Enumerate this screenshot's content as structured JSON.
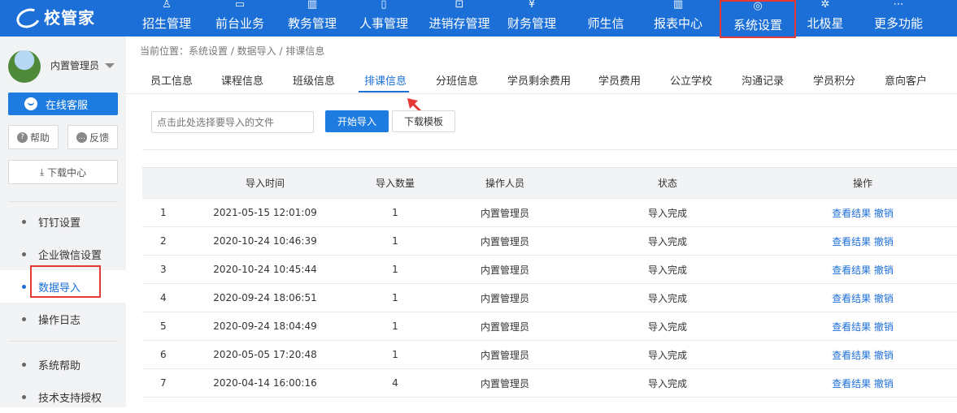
{
  "app": {
    "logo_text": "校管家"
  },
  "topnav": {
    "items": [
      {
        "label": "招生管理",
        "icon": "add-user-icon",
        "glyph": "♙"
      },
      {
        "label": "前台业务",
        "icon": "desk-icon",
        "glyph": "▭"
      },
      {
        "label": "教务管理",
        "icon": "book-icon",
        "glyph": "▥"
      },
      {
        "label": "人事管理",
        "icon": "person-icon",
        "glyph": "▯"
      },
      {
        "label": "进销存管理",
        "icon": "inventory-icon",
        "glyph": "⊡"
      },
      {
        "label": "财务管理",
        "icon": "finance-icon",
        "glyph": "¥"
      },
      {
        "label": "师生信",
        "icon": "message-icon",
        "glyph": ""
      },
      {
        "label": "报表中心",
        "icon": "report-icon",
        "glyph": "▥"
      },
      {
        "label": "系统设置",
        "icon": "settings-icon",
        "glyph": "◎"
      },
      {
        "label": "北极星",
        "icon": "star-icon",
        "glyph": "✲"
      },
      {
        "label": "更多功能",
        "icon": "more-icon",
        "glyph": "⋯"
      }
    ],
    "active_index": 8
  },
  "sidebar": {
    "username": "内置管理员",
    "online_service": "在线客服",
    "help": "帮助",
    "feedback": "反馈",
    "download_center": "下载中心",
    "menu": [
      {
        "label": "钉钉设置"
      },
      {
        "label": "企业微信设置"
      },
      {
        "label": "数据导入"
      },
      {
        "label": "操作日志"
      },
      {
        "label": "系统帮助"
      },
      {
        "label": "技术支持授权"
      }
    ],
    "active_index": 2
  },
  "breadcrumb": "当前位置：系统设置 / 数据导入 / 排课信息",
  "tabs": [
    "员工信息",
    "课程信息",
    "班级信息",
    "排课信息",
    "分班信息",
    "学员剩余费用",
    "学员费用",
    "公立学校",
    "沟通记录",
    "学员积分",
    "意向客户"
  ],
  "active_tab": 3,
  "toolbar": {
    "file_placeholder": "点击此处选择要导入的文件",
    "import_label": "开始导入",
    "template_label": "下载模板"
  },
  "table": {
    "columns": [
      "",
      "导入时间",
      "导入数量",
      "操作人员",
      "状态",
      "操作"
    ],
    "rows": [
      {
        "idx": "1",
        "time": "2021-05-15 12:01:09",
        "count": "1",
        "operator": "内置管理员",
        "status": "导入完成",
        "view": "查看结果",
        "undo": "撤销"
      },
      {
        "idx": "2",
        "time": "2020-10-24 10:46:39",
        "count": "1",
        "operator": "内置管理员",
        "status": "导入完成",
        "view": "查看结果",
        "undo": "撤销"
      },
      {
        "idx": "3",
        "time": "2020-10-24 10:45:44",
        "count": "1",
        "operator": "内置管理员",
        "status": "导入完成",
        "view": "查看结果",
        "undo": "撤销"
      },
      {
        "idx": "4",
        "time": "2020-09-24 18:06:51",
        "count": "1",
        "operator": "内置管理员",
        "status": "导入完成",
        "view": "查看结果",
        "undo": "撤销"
      },
      {
        "idx": "5",
        "time": "2020-09-24 18:04:49",
        "count": "1",
        "operator": "内置管理员",
        "status": "导入完成",
        "view": "查看结果",
        "undo": "撤销"
      },
      {
        "idx": "6",
        "time": "2020-05-05 17:20:48",
        "count": "1",
        "operator": "内置管理员",
        "status": "导入完成",
        "view": "查看结果",
        "undo": "撤销"
      },
      {
        "idx": "7",
        "time": "2020-04-14 16:00:16",
        "count": "4",
        "operator": "内置管理员",
        "status": "导入完成",
        "view": "查看结果",
        "undo": "撤销"
      }
    ]
  },
  "colors": {
    "nav_bg": "#1b6fd6",
    "accent": "#1e7be0",
    "highlight": "#e53935",
    "link": "#1e6fd9"
  }
}
